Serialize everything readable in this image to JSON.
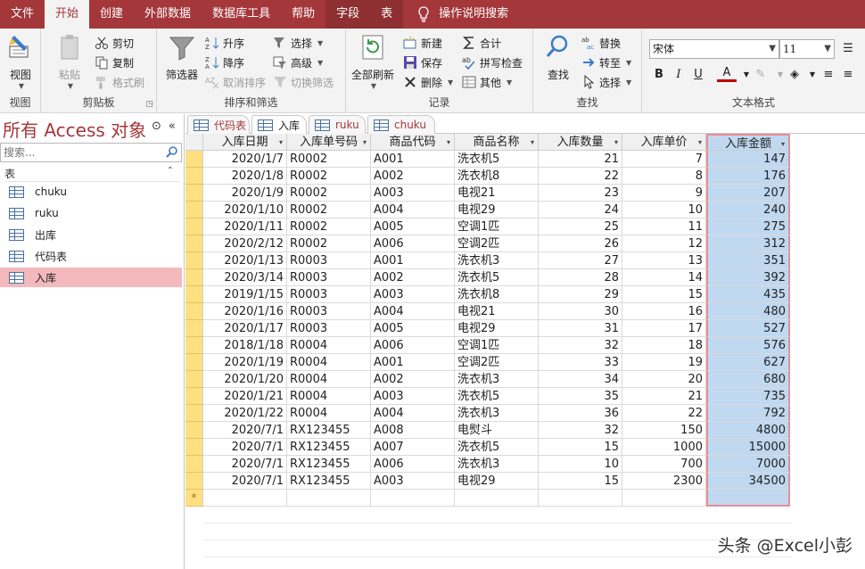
{
  "menu": {
    "tabs": [
      "文件",
      "开始",
      "创建",
      "外部数据",
      "数据库工具",
      "帮助",
      "字段",
      "表"
    ],
    "active_tab": "开始",
    "tell_me": "操作说明搜索"
  },
  "ribbon": {
    "view": {
      "label": "视图",
      "group": "视图"
    },
    "clipboard": {
      "paste": "粘贴",
      "cut": "剪切",
      "copy": "复制",
      "format_painter": "格式刷",
      "group": "剪贴板"
    },
    "sort_filter": {
      "filter": "筛选器",
      "ascending": "升序",
      "descending": "降序",
      "remove_sort": "取消排序",
      "selection": "选择",
      "advanced": "高级",
      "toggle_filter": "切换筛选",
      "group": "排序和筛选"
    },
    "records": {
      "refresh_all": "全部刷新",
      "new": "新建",
      "save": "保存",
      "delete": "删除",
      "totals": "合计",
      "spelling": "拼写检查",
      "more": "其他",
      "group": "记录"
    },
    "find": {
      "find": "查找",
      "replace": "替换",
      "goto": "转至",
      "select": "选择",
      "group": "查找"
    },
    "text_format": {
      "font": "宋体",
      "size": "11",
      "bold": "B",
      "italic": "I",
      "underline": "U",
      "font_color": "A",
      "group": "文本格式",
      "font_color_hex": "#c00000",
      "highlight_hex": "#ffff00"
    }
  },
  "nav": {
    "title": "所有 Access 对象",
    "search_placeholder": "搜索...",
    "section": "表",
    "items": [
      {
        "label": "chuku",
        "selected": false
      },
      {
        "label": "ruku",
        "selected": false
      },
      {
        "label": "出库",
        "selected": false
      },
      {
        "label": "代码表",
        "selected": false
      },
      {
        "label": "入库",
        "selected": true
      }
    ]
  },
  "doc_tabs": [
    {
      "label": "代码表",
      "active": false
    },
    {
      "label": "入库",
      "active": true
    },
    {
      "label": "ruku",
      "active": false
    },
    {
      "label": "chuku",
      "active": false
    }
  ],
  "table": {
    "columns": [
      "入库日期",
      "入库单号码",
      "商品代码",
      "商品名称",
      "入库数量",
      "入库单价",
      "入库金额"
    ],
    "highlighted_column": 6,
    "rows": [
      [
        "2020/1/7",
        "R0002",
        "A001",
        "洗衣机5",
        "21",
        "7",
        "147"
      ],
      [
        "2020/1/8",
        "R0002",
        "A002",
        "洗衣机8",
        "22",
        "8",
        "176"
      ],
      [
        "2020/1/9",
        "R0002",
        "A003",
        "电视21",
        "23",
        "9",
        "207"
      ],
      [
        "2020/1/10",
        "R0002",
        "A004",
        "电视29",
        "24",
        "10",
        "240"
      ],
      [
        "2020/1/11",
        "R0002",
        "A005",
        "空调1匹",
        "25",
        "11",
        "275"
      ],
      [
        "2020/2/12",
        "R0002",
        "A006",
        "空调2匹",
        "26",
        "12",
        "312"
      ],
      [
        "2020/1/13",
        "R0003",
        "A001",
        "洗衣机3",
        "27",
        "13",
        "351"
      ],
      [
        "2020/3/14",
        "R0003",
        "A002",
        "洗衣机5",
        "28",
        "14",
        "392"
      ],
      [
        "2019/1/15",
        "R0003",
        "A003",
        "洗衣机8",
        "29",
        "15",
        "435"
      ],
      [
        "2020/1/16",
        "R0003",
        "A004",
        "电视21",
        "30",
        "16",
        "480"
      ],
      [
        "2020/1/17",
        "R0003",
        "A005",
        "电视29",
        "31",
        "17",
        "527"
      ],
      [
        "2018/1/18",
        "R0004",
        "A006",
        "空调1匹",
        "32",
        "18",
        "576"
      ],
      [
        "2020/1/19",
        "R0004",
        "A001",
        "空调2匹",
        "33",
        "19",
        "627"
      ],
      [
        "2020/1/20",
        "R0004",
        "A002",
        "洗衣机3",
        "34",
        "20",
        "680"
      ],
      [
        "2020/1/21",
        "R0004",
        "A003",
        "洗衣机5",
        "35",
        "21",
        "735"
      ],
      [
        "2020/1/22",
        "R0004",
        "A004",
        "洗衣机3",
        "36",
        "22",
        "792"
      ],
      [
        "2020/7/1",
        "RX123455",
        "A008",
        "电熨斗",
        "32",
        "150",
        "4800"
      ],
      [
        "2020/7/1",
        "RX123455",
        "A007",
        "洗衣机5",
        "15",
        "1000",
        "15000"
      ],
      [
        "2020/7/1",
        "RX123455",
        "A006",
        "洗衣机3",
        "10",
        "700",
        "7000"
      ],
      [
        "2020/7/1",
        "RX123455",
        "A003",
        "电视29",
        "15",
        "2300",
        "34500"
      ]
    ],
    "new_record_marker": "*"
  },
  "watermark": "头条 @Excel小彭",
  "colors": {
    "accent": "#a4373a",
    "selected_nav": "#f4b9bc",
    "column_highlight": "#c0d8f0",
    "row_selector": "#fedf82"
  }
}
